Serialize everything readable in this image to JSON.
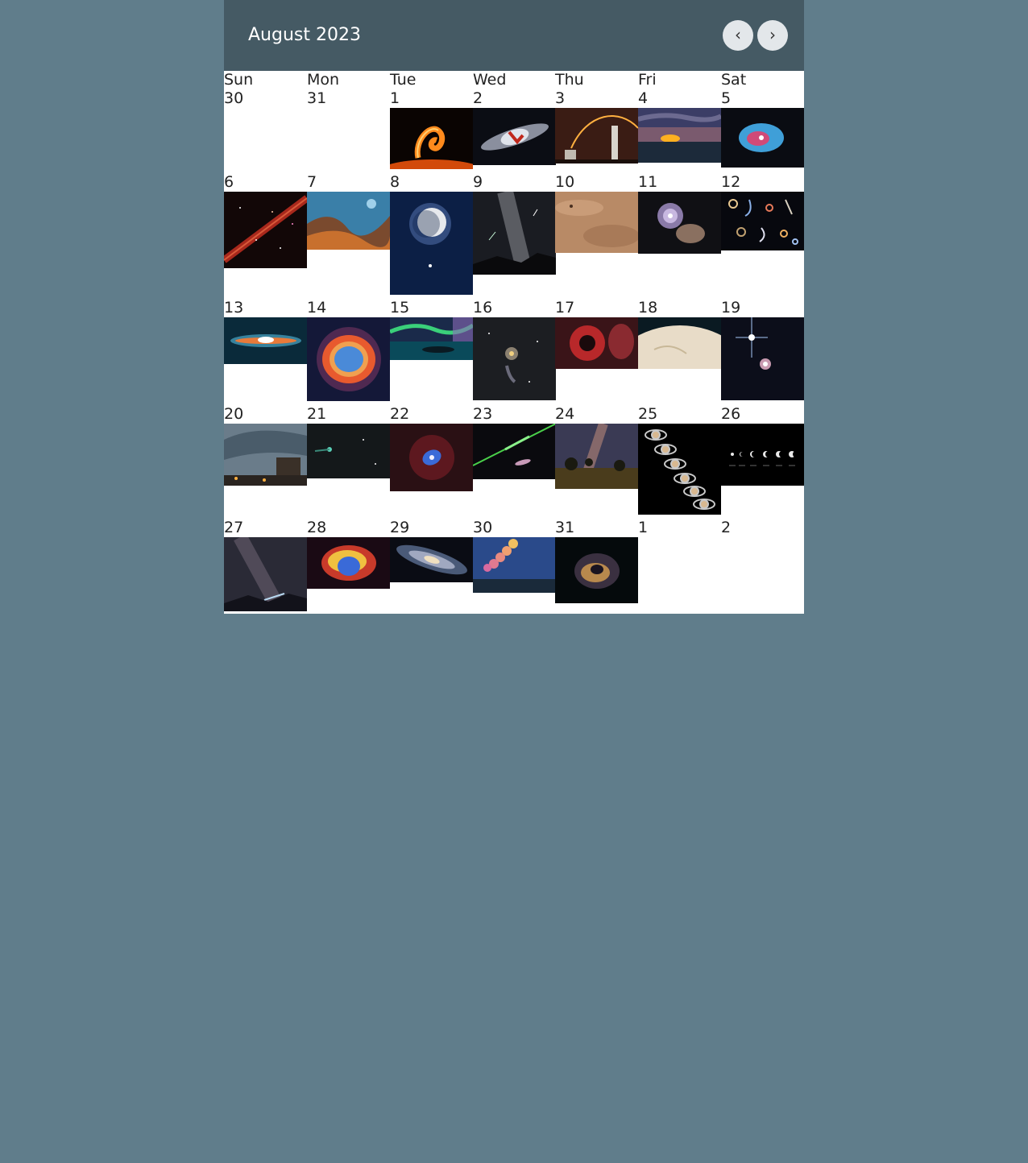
{
  "header": {
    "title": "August 2023",
    "prev_label": "‹",
    "next_label": "›"
  },
  "weekdays": [
    "Sun",
    "Mon",
    "Tue",
    "Wed",
    "Thu",
    "Fri",
    "Sat"
  ],
  "weeks": [
    {
      "days": [
        {
          "num": "30",
          "image": null
        },
        {
          "num": "31",
          "image": null
        },
        {
          "num": "1",
          "image": "solar-prominence"
        },
        {
          "num": "2",
          "image": "m82-galaxy"
        },
        {
          "num": "3",
          "image": "rocket-launch-trails"
        },
        {
          "num": "4",
          "image": "moonrise-clouds"
        },
        {
          "num": "5",
          "image": "blue-planetary-nebula"
        }
      ]
    },
    {
      "days": [
        {
          "num": "6",
          "image": "red-meteor-streak"
        },
        {
          "num": "7",
          "image": "carina-nebula-cliffs"
        },
        {
          "num": "8",
          "image": "crescent-moon-venus"
        },
        {
          "num": "9",
          "image": "milky-way-meteors"
        },
        {
          "num": "10",
          "image": "mars-surface"
        },
        {
          "num": "11",
          "image": "whirlpool-galaxy"
        },
        {
          "num": "12",
          "image": "galaxy-alphabet"
        }
      ]
    },
    {
      "days": [
        {
          "num": "13",
          "image": "sombrero-galaxy"
        },
        {
          "num": "14",
          "image": "ring-nebula"
        },
        {
          "num": "15",
          "image": "aurora-lake"
        },
        {
          "num": "16",
          "image": "spiral-galaxy-starfield"
        },
        {
          "num": "17",
          "image": "red-emission-nebula"
        },
        {
          "num": "18",
          "image": "icy-moon-surface"
        },
        {
          "num": "19",
          "image": "star-spikes-nebula"
        }
      ]
    },
    {
      "days": [
        {
          "num": "20",
          "image": "storm-shelf-cloud"
        },
        {
          "num": "21",
          "image": "green-comet"
        },
        {
          "num": "22",
          "image": "red-nebula-blue-core"
        },
        {
          "num": "23",
          "image": "green-fireball"
        },
        {
          "num": "24",
          "image": "milky-way-landscape"
        },
        {
          "num": "25",
          "image": "saturn-sequence"
        },
        {
          "num": "26",
          "image": "moon-phases"
        }
      ]
    },
    {
      "days": [
        {
          "num": "27",
          "image": "milky-way-comet"
        },
        {
          "num": "28",
          "image": "pelican-nebula"
        },
        {
          "num": "29",
          "image": "andromeda-galaxy"
        },
        {
          "num": "30",
          "image": "moonrise-sequence"
        },
        {
          "num": "31",
          "image": "cosmic-dust-cloud"
        },
        {
          "num": "1",
          "image": null
        },
        {
          "num": "2",
          "image": null
        }
      ]
    }
  ]
}
